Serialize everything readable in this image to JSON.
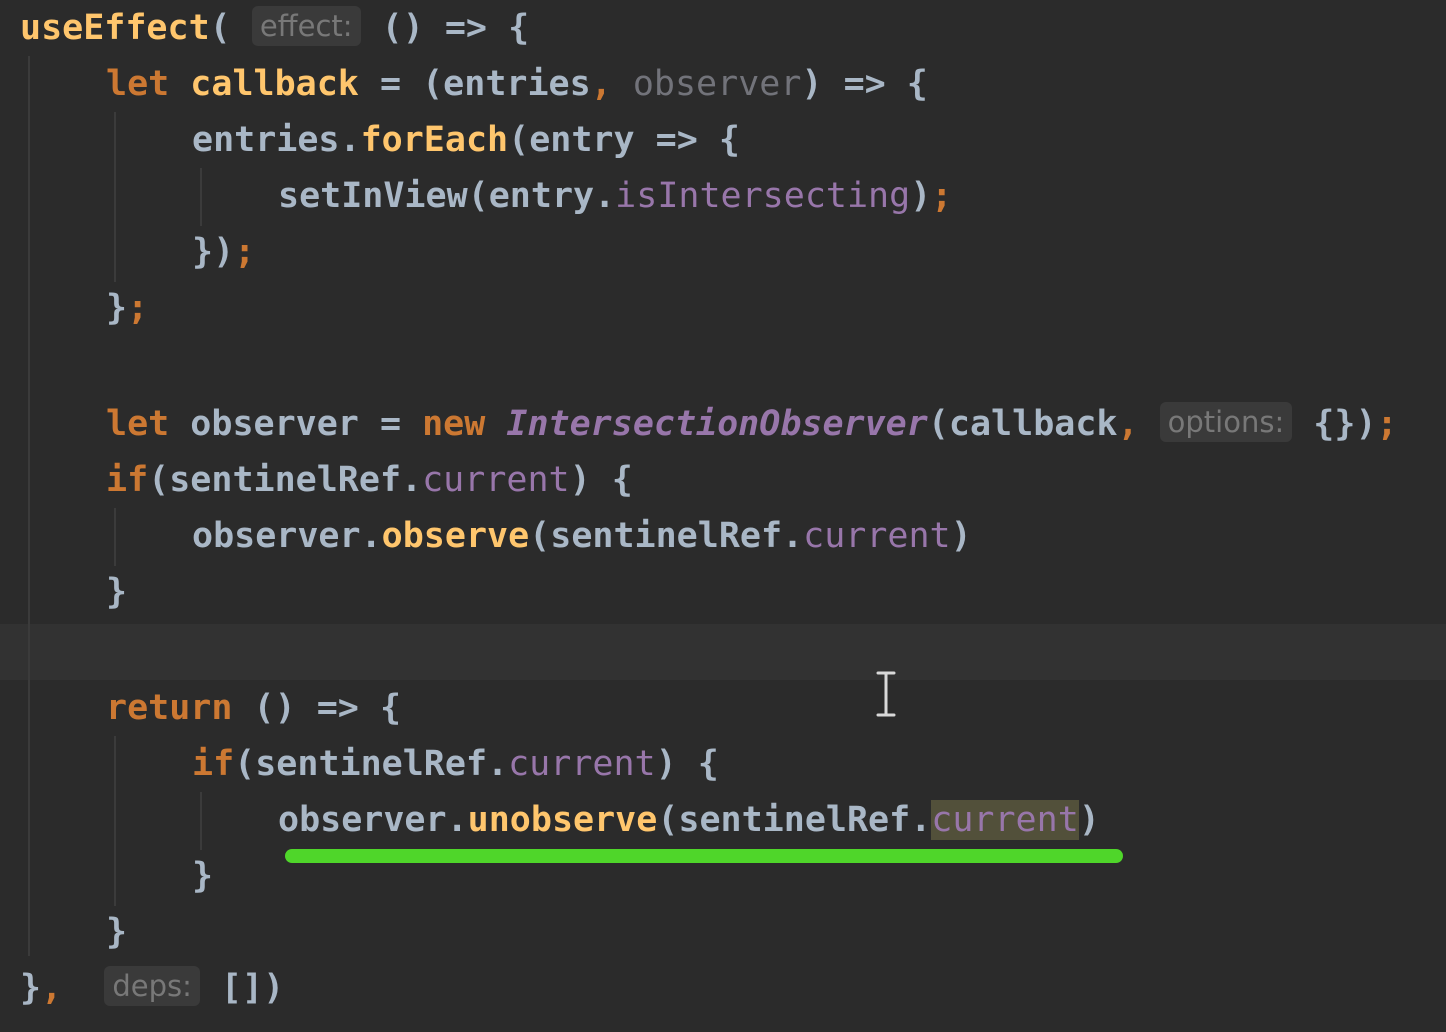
{
  "editor": {
    "hints": {
      "effect": "effect:",
      "options": "options:",
      "deps": "deps:"
    },
    "tokens": {
      "useEffect": "useEffect",
      "let": "let",
      "callback": "callback",
      "entries": "entries",
      "observer": "observer",
      "forEach": "forEach",
      "entry": "entry",
      "setInView": "setInView",
      "isIntersecting": "isIntersecting",
      "new": "new",
      "IntersectionObserver": "IntersectionObserver",
      "if": "if",
      "sentinelRef": "sentinelRef",
      "current": "current",
      "observe": "observe",
      "return": "return",
      "unobserve": "unobserve"
    },
    "colors": {
      "background": "#2b2b2b",
      "keyword": "#cc7832",
      "function": "#ffc66d",
      "property": "#9876aa",
      "text": "#a9b7c6",
      "underline_annotation": "#4fd62a"
    }
  }
}
